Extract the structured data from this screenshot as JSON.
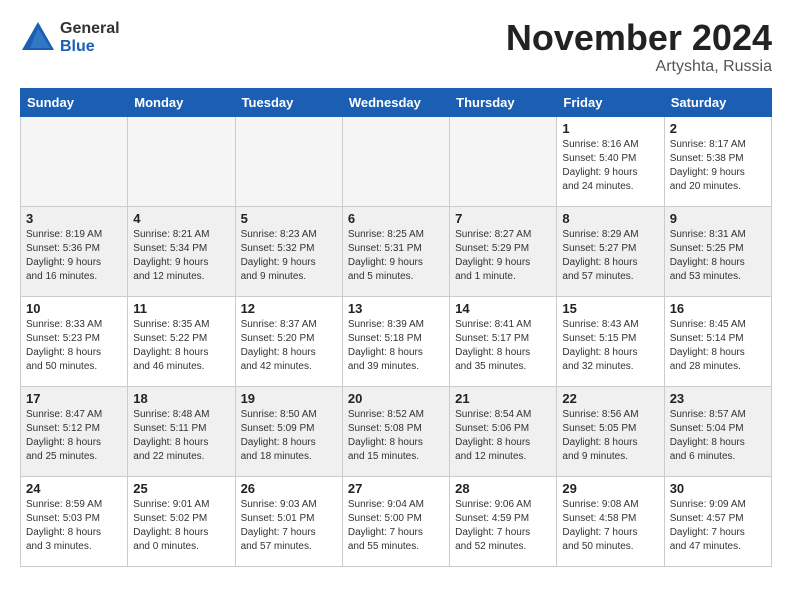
{
  "logo": {
    "general": "General",
    "blue": "Blue"
  },
  "title": "November 2024",
  "location": "Artyshta, Russia",
  "weekdays": [
    "Sunday",
    "Monday",
    "Tuesday",
    "Wednesday",
    "Thursday",
    "Friday",
    "Saturday"
  ],
  "weeks": [
    [
      {
        "day": "",
        "info": ""
      },
      {
        "day": "",
        "info": ""
      },
      {
        "day": "",
        "info": ""
      },
      {
        "day": "",
        "info": ""
      },
      {
        "day": "",
        "info": ""
      },
      {
        "day": "1",
        "info": "Sunrise: 8:16 AM\nSunset: 5:40 PM\nDaylight: 9 hours\nand 24 minutes."
      },
      {
        "day": "2",
        "info": "Sunrise: 8:17 AM\nSunset: 5:38 PM\nDaylight: 9 hours\nand 20 minutes."
      }
    ],
    [
      {
        "day": "3",
        "info": "Sunrise: 8:19 AM\nSunset: 5:36 PM\nDaylight: 9 hours\nand 16 minutes."
      },
      {
        "day": "4",
        "info": "Sunrise: 8:21 AM\nSunset: 5:34 PM\nDaylight: 9 hours\nand 12 minutes."
      },
      {
        "day": "5",
        "info": "Sunrise: 8:23 AM\nSunset: 5:32 PM\nDaylight: 9 hours\nand 9 minutes."
      },
      {
        "day": "6",
        "info": "Sunrise: 8:25 AM\nSunset: 5:31 PM\nDaylight: 9 hours\nand 5 minutes."
      },
      {
        "day": "7",
        "info": "Sunrise: 8:27 AM\nSunset: 5:29 PM\nDaylight: 9 hours\nand 1 minute."
      },
      {
        "day": "8",
        "info": "Sunrise: 8:29 AM\nSunset: 5:27 PM\nDaylight: 8 hours\nand 57 minutes."
      },
      {
        "day": "9",
        "info": "Sunrise: 8:31 AM\nSunset: 5:25 PM\nDaylight: 8 hours\nand 53 minutes."
      }
    ],
    [
      {
        "day": "10",
        "info": "Sunrise: 8:33 AM\nSunset: 5:23 PM\nDaylight: 8 hours\nand 50 minutes."
      },
      {
        "day": "11",
        "info": "Sunrise: 8:35 AM\nSunset: 5:22 PM\nDaylight: 8 hours\nand 46 minutes."
      },
      {
        "day": "12",
        "info": "Sunrise: 8:37 AM\nSunset: 5:20 PM\nDaylight: 8 hours\nand 42 minutes."
      },
      {
        "day": "13",
        "info": "Sunrise: 8:39 AM\nSunset: 5:18 PM\nDaylight: 8 hours\nand 39 minutes."
      },
      {
        "day": "14",
        "info": "Sunrise: 8:41 AM\nSunset: 5:17 PM\nDaylight: 8 hours\nand 35 minutes."
      },
      {
        "day": "15",
        "info": "Sunrise: 8:43 AM\nSunset: 5:15 PM\nDaylight: 8 hours\nand 32 minutes."
      },
      {
        "day": "16",
        "info": "Sunrise: 8:45 AM\nSunset: 5:14 PM\nDaylight: 8 hours\nand 28 minutes."
      }
    ],
    [
      {
        "day": "17",
        "info": "Sunrise: 8:47 AM\nSunset: 5:12 PM\nDaylight: 8 hours\nand 25 minutes."
      },
      {
        "day": "18",
        "info": "Sunrise: 8:48 AM\nSunset: 5:11 PM\nDaylight: 8 hours\nand 22 minutes."
      },
      {
        "day": "19",
        "info": "Sunrise: 8:50 AM\nSunset: 5:09 PM\nDaylight: 8 hours\nand 18 minutes."
      },
      {
        "day": "20",
        "info": "Sunrise: 8:52 AM\nSunset: 5:08 PM\nDaylight: 8 hours\nand 15 minutes."
      },
      {
        "day": "21",
        "info": "Sunrise: 8:54 AM\nSunset: 5:06 PM\nDaylight: 8 hours\nand 12 minutes."
      },
      {
        "day": "22",
        "info": "Sunrise: 8:56 AM\nSunset: 5:05 PM\nDaylight: 8 hours\nand 9 minutes."
      },
      {
        "day": "23",
        "info": "Sunrise: 8:57 AM\nSunset: 5:04 PM\nDaylight: 8 hours\nand 6 minutes."
      }
    ],
    [
      {
        "day": "24",
        "info": "Sunrise: 8:59 AM\nSunset: 5:03 PM\nDaylight: 8 hours\nand 3 minutes."
      },
      {
        "day": "25",
        "info": "Sunrise: 9:01 AM\nSunset: 5:02 PM\nDaylight: 8 hours\nand 0 minutes."
      },
      {
        "day": "26",
        "info": "Sunrise: 9:03 AM\nSunset: 5:01 PM\nDaylight: 7 hours\nand 57 minutes."
      },
      {
        "day": "27",
        "info": "Sunrise: 9:04 AM\nSunset: 5:00 PM\nDaylight: 7 hours\nand 55 minutes."
      },
      {
        "day": "28",
        "info": "Sunrise: 9:06 AM\nSunset: 4:59 PM\nDaylight: 7 hours\nand 52 minutes."
      },
      {
        "day": "29",
        "info": "Sunrise: 9:08 AM\nSunset: 4:58 PM\nDaylight: 7 hours\nand 50 minutes."
      },
      {
        "day": "30",
        "info": "Sunrise: 9:09 AM\nSunset: 4:57 PM\nDaylight: 7 hours\nand 47 minutes."
      }
    ]
  ]
}
